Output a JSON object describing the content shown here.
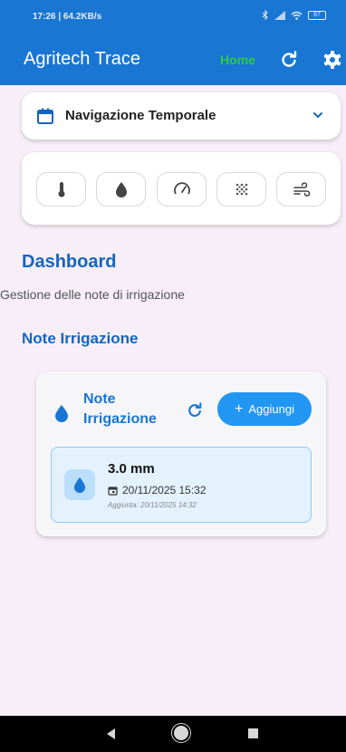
{
  "status_bar": {
    "time": "17:26 | 64.2KB/s",
    "battery": "87"
  },
  "app_bar": {
    "title": "Agritech Trace",
    "home_label": "Home"
  },
  "temporal_nav": {
    "label": "Navigazione Temporale"
  },
  "sensor_buttons": [
    {
      "icon": "thermometer-icon"
    },
    {
      "icon": "water-drop-icon"
    },
    {
      "icon": "gauge-icon"
    },
    {
      "icon": "dots-grid-icon"
    },
    {
      "icon": "wind-icon"
    }
  ],
  "dashboard": {
    "title": "Dashboard",
    "subtitle": "Gestione delle note di irrigazione"
  },
  "section": {
    "title": "Note Irrigazione"
  },
  "notes_card": {
    "title": "Note Irrigazione",
    "add_label": "Aggiungi",
    "entries": [
      {
        "amount": "3.0 mm",
        "date": "20/11/2025 15:32",
        "added": "Aggiunta: 20/11/2025 14:32"
      }
    ]
  },
  "colors": {
    "primary": "#1976d2",
    "accent": "#2196f3",
    "home_green": "#2ecc40",
    "background": "#f7eef8"
  }
}
